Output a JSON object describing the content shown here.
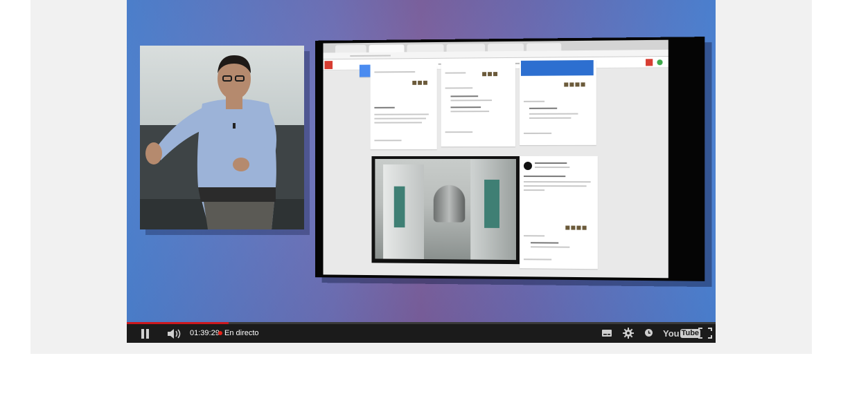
{
  "player": {
    "current_time": "01:39:29",
    "live_label": "En directo",
    "progress_fraction": 0.173,
    "brand": {
      "prefix": "You",
      "suffix": "Tube"
    },
    "colors": {
      "progress": "#cc181e",
      "live_dot": "#e62117",
      "control_bar": "#1b1b1b"
    }
  },
  "icons": {
    "pause": "pause-icon",
    "volume": "volume-icon",
    "subtitles": "subtitles-icon",
    "settings": "gear-icon",
    "watch_later": "clock-icon",
    "fullscreen": "fullscreen-icon"
  }
}
